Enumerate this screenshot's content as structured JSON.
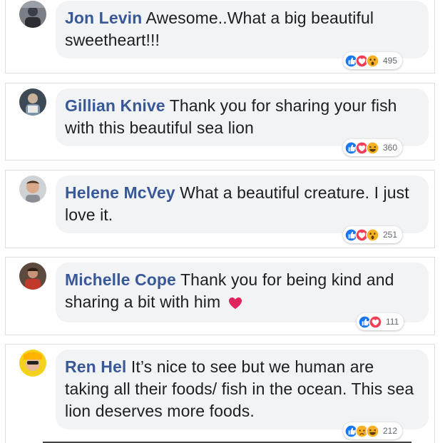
{
  "colors": {
    "author": "#385898",
    "bubble": "#f2f3f5",
    "text": "#1c1e21",
    "like": "#1877f2",
    "love": "#f33e58",
    "haha": "#f7b125"
  },
  "comments": [
    {
      "author": "Jon Levin",
      "text": "Awesome..What a big beautiful sweetheart!!!",
      "reactions": [
        "like-icon",
        "love-icon",
        "wow-icon"
      ],
      "count": "495"
    },
    {
      "author": "Gillian Knive",
      "text": "Thank you for sharing your fish with this beautiful sea lion",
      "reactions": [
        "like-icon",
        "love-icon",
        "haha-icon"
      ],
      "count": "360"
    },
    {
      "author": "Helene McVey",
      "text": "What a beautiful creature. I just love it.",
      "reactions": [
        "like-icon",
        "love-icon",
        "wow-icon"
      ],
      "count": "251"
    },
    {
      "author": "Michelle Cope",
      "text": "Thank you for being kind and sharing a bit with him",
      "emoji": "red-heart-icon",
      "reactions": [
        "like-icon",
        "love-icon"
      ],
      "count": "111"
    },
    {
      "author": "Ren Hel",
      "text": "It’s nice to see but we human are taking all their foods/ fish in the ocean. This sea lion deserves more foods.",
      "reactions": [
        "like-icon",
        "sad-icon",
        "haha-icon"
      ],
      "count": "212"
    }
  ]
}
